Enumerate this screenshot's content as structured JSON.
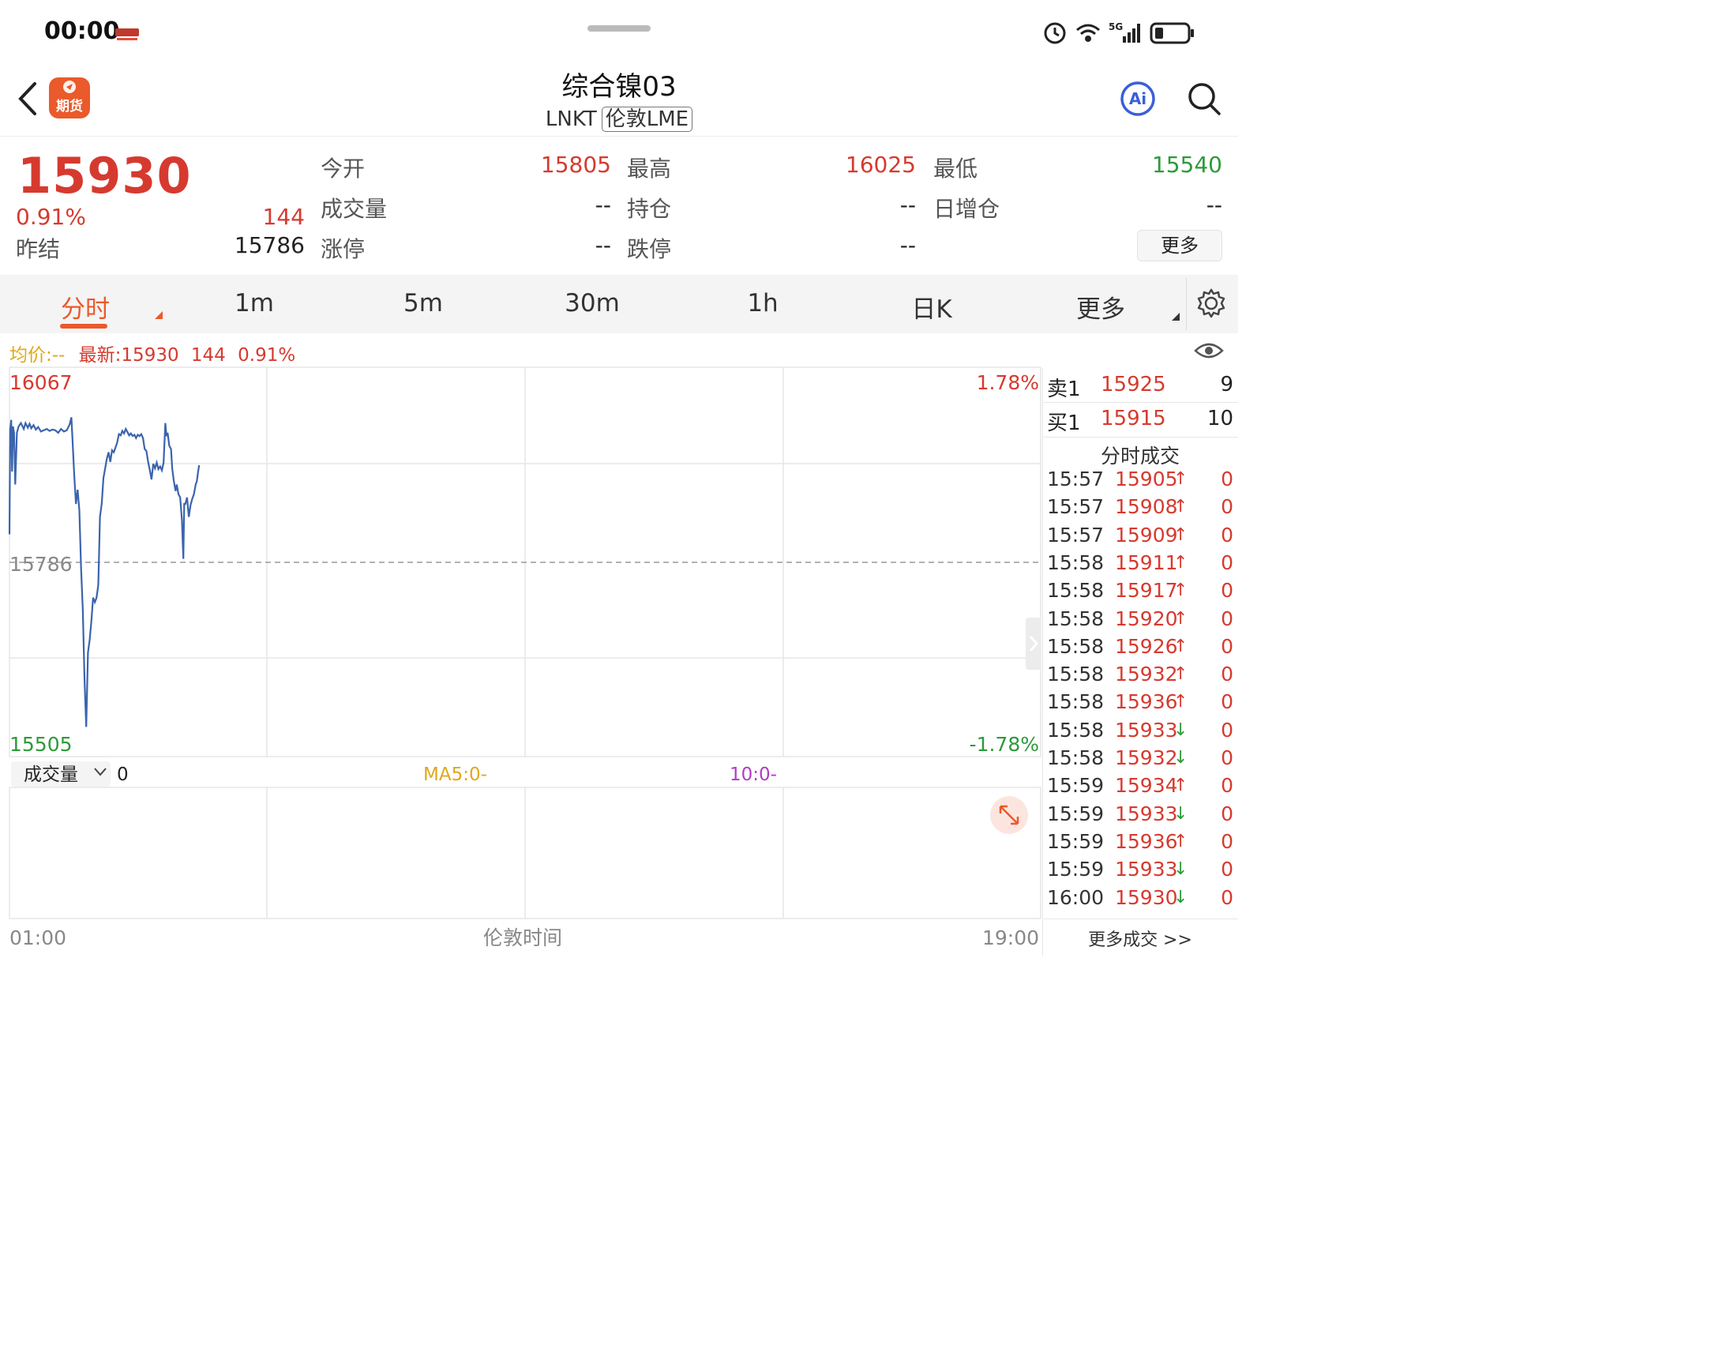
{
  "status_bar": {
    "time": "00:00",
    "network": "5G"
  },
  "header": {
    "app_badge": "期货",
    "title": "综合镍03",
    "code": "LNKT",
    "exchange_tag": "伦敦LME",
    "ai_label": "Ai"
  },
  "quote": {
    "last": "15930",
    "change_pct": "0.91%",
    "change": "144",
    "prev_settle_label": "昨结",
    "prev_settle": "15786",
    "open_label": "今开",
    "open": "15805",
    "high_label": "最高",
    "high": "16025",
    "low_label": "最低",
    "low": "15540",
    "volume_label": "成交量",
    "volume": "--",
    "oi_label": "持仓",
    "oi": "--",
    "oi_change_label": "日增仓",
    "oi_change": "--",
    "limit_up_label": "涨停",
    "limit_up": "--",
    "limit_down_label": "跌停",
    "limit_down": "--",
    "more_label": "更多"
  },
  "tabs": [
    "分时",
    "1m",
    "5m",
    "30m",
    "1h",
    "日K",
    "更多"
  ],
  "info_line": {
    "avg_label": "均价:--",
    "latest_label": "最新:15930",
    "change": "144",
    "pct": "0.91%"
  },
  "chart_data": {
    "type": "line",
    "y_max_label": "16067",
    "y_min_label": "15505",
    "y_ref_label": "15786",
    "pct_top": "1.78%",
    "pct_bottom": "-1.78%",
    "x_start": "01:00",
    "x_end": "19:00",
    "x_axis_label": "伦敦时间",
    "ylim": [
      15505,
      16067
    ],
    "reference": 15786,
    "grid": true,
    "line_color": "#3b64ad",
    "points": [
      [
        0,
        15833
      ],
      [
        0.012,
        15995
      ],
      [
        0.03,
        16010
      ],
      [
        0.045,
        15930
      ],
      [
        0.06,
        16000
      ],
      [
        0.08,
        15990
      ],
      [
        0.1,
        15910
      ],
      [
        0.13,
        15990
      ],
      [
        0.16,
        16000
      ],
      [
        0.2,
        16005
      ],
      [
        0.25,
        15996
      ],
      [
        0.28,
        16005
      ],
      [
        0.32,
        15998
      ],
      [
        0.35,
        16004
      ],
      [
        0.38,
        15997
      ],
      [
        0.42,
        16002
      ],
      [
        0.46,
        15995
      ],
      [
        0.5,
        15999
      ],
      [
        0.55,
        15992
      ],
      [
        0.6,
        15994
      ],
      [
        0.65,
        15996
      ],
      [
        0.7,
        15993
      ],
      [
        0.75,
        15995
      ],
      [
        0.8,
        15994
      ],
      [
        0.85,
        15990
      ],
      [
        0.9,
        15996
      ],
      [
        0.95,
        15992
      ],
      [
        1.0,
        15994
      ],
      [
        1.05,
        16003
      ],
      [
        1.08,
        16014
      ],
      [
        1.1,
        15980
      ],
      [
        1.13,
        15925
      ],
      [
        1.16,
        15880
      ],
      [
        1.19,
        15902
      ],
      [
        1.22,
        15870
      ],
      [
        1.25,
        15780
      ],
      [
        1.28,
        15715
      ],
      [
        1.31,
        15610
      ],
      [
        1.34,
        15535
      ],
      [
        1.37,
        15650
      ],
      [
        1.4,
        15670
      ],
      [
        1.43,
        15700
      ],
      [
        1.46,
        15735
      ],
      [
        1.49,
        15728
      ],
      [
        1.52,
        15735
      ],
      [
        1.55,
        15755
      ],
      [
        1.58,
        15860
      ],
      [
        1.61,
        15880
      ],
      [
        1.64,
        15920
      ],
      [
        1.67,
        15935
      ],
      [
        1.7,
        15950
      ],
      [
        1.73,
        15960
      ],
      [
        1.76,
        15945
      ],
      [
        1.79,
        15963
      ],
      [
        1.82,
        15960
      ],
      [
        1.85,
        15967
      ],
      [
        1.88,
        15975
      ],
      [
        1.91,
        15988
      ],
      [
        1.94,
        15986
      ],
      [
        1.97,
        15993
      ],
      [
        2.0,
        15989
      ],
      [
        2.03,
        15996
      ],
      [
        2.06,
        15991
      ],
      [
        2.09,
        15986
      ],
      [
        2.12,
        15989
      ],
      [
        2.15,
        15985
      ],
      [
        2.18,
        15987
      ],
      [
        2.21,
        15982
      ],
      [
        2.24,
        15987
      ],
      [
        2.27,
        15985
      ],
      [
        2.3,
        15988
      ],
      [
        2.33,
        15982
      ],
      [
        2.36,
        15965
      ],
      [
        2.39,
        15962
      ],
      [
        2.42,
        15945
      ],
      [
        2.45,
        15932
      ],
      [
        2.48,
        15918
      ],
      [
        2.51,
        15942
      ],
      [
        2.54,
        15935
      ],
      [
        2.57,
        15944
      ],
      [
        2.6,
        15934
      ],
      [
        2.63,
        15938
      ],
      [
        2.66,
        15932
      ],
      [
        2.69,
        15944
      ],
      [
        2.72,
        16005
      ],
      [
        2.74,
        15985
      ],
      [
        2.76,
        15990
      ],
      [
        2.79,
        15970
      ],
      [
        2.82,
        15965
      ],
      [
        2.84,
        15935
      ],
      [
        2.87,
        15915
      ],
      [
        2.9,
        15900
      ],
      [
        2.92,
        15910
      ],
      [
        2.95,
        15895
      ],
      [
        2.98,
        15890
      ],
      [
        3.01,
        15855
      ],
      [
        3.035,
        15795
      ],
      [
        3.05,
        15880
      ],
      [
        3.07,
        15880
      ],
      [
        3.1,
        15890
      ],
      [
        3.13,
        15860
      ],
      [
        3.16,
        15878
      ],
      [
        3.19,
        15888
      ],
      [
        3.22,
        15895
      ],
      [
        3.25,
        15910
      ],
      [
        3.27,
        15915
      ],
      [
        3.29,
        15928
      ],
      [
        3.31,
        15940
      ]
    ]
  },
  "volume_panel": {
    "selector_label": "成交量",
    "value": "0",
    "ma5_label": "MA5:0-",
    "ma10_label": "10:0-"
  },
  "order_book": {
    "ask_label": "卖1",
    "ask_price": "15925",
    "ask_qty": "9",
    "bid_label": "买1",
    "bid_price": "15915",
    "bid_qty": "10"
  },
  "trades": {
    "title": "分时成交",
    "more_label": "更多成交 >>",
    "rows": [
      {
        "time": "15:57",
        "price": "15905",
        "arrow": "↑",
        "qty": "0"
      },
      {
        "time": "15:57",
        "price": "15908",
        "arrow": "↑",
        "qty": "0"
      },
      {
        "time": "15:57",
        "price": "15909",
        "arrow": "↑",
        "qty": "0"
      },
      {
        "time": "15:58",
        "price": "15911",
        "arrow": "↑",
        "qty": "0"
      },
      {
        "time": "15:58",
        "price": "15917",
        "arrow": "↑",
        "qty": "0"
      },
      {
        "time": "15:58",
        "price": "15920",
        "arrow": "↑",
        "qty": "0"
      },
      {
        "time": "15:58",
        "price": "15926",
        "arrow": "↑",
        "qty": "0"
      },
      {
        "time": "15:58",
        "price": "15932",
        "arrow": "↑",
        "qty": "0"
      },
      {
        "time": "15:58",
        "price": "15936",
        "arrow": "↑",
        "qty": "0"
      },
      {
        "time": "15:58",
        "price": "15933",
        "arrow": "↓",
        "qty": "0"
      },
      {
        "time": "15:58",
        "price": "15932",
        "arrow": "↓",
        "qty": "0"
      },
      {
        "time": "15:59",
        "price": "15934",
        "arrow": "↑",
        "qty": "0"
      },
      {
        "time": "15:59",
        "price": "15933",
        "arrow": "↓",
        "qty": "0"
      },
      {
        "time": "15:59",
        "price": "15936",
        "arrow": "↑",
        "qty": "0"
      },
      {
        "time": "15:59",
        "price": "15933",
        "arrow": "↓",
        "qty": "0"
      },
      {
        "time": "16:00",
        "price": "15930",
        "arrow": "↓",
        "qty": "0"
      }
    ]
  },
  "colors": {
    "up": "#d63a2f",
    "down": "#2e9a3a",
    "accent": "#ea5a2b",
    "line": "#3b64ad"
  }
}
